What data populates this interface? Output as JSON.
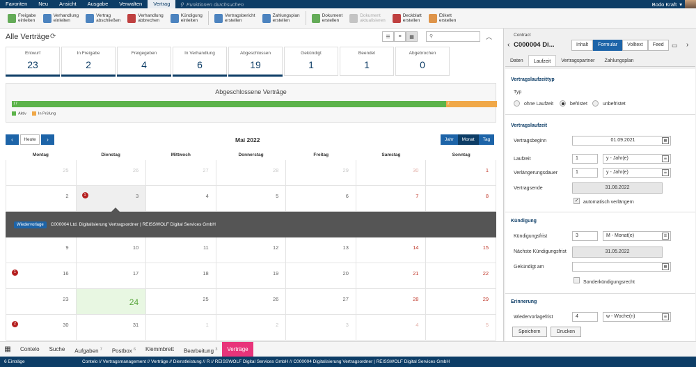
{
  "menu": {
    "items": [
      "Favoriten",
      "Neu",
      "Ansicht",
      "Ausgabe",
      "Verwalten",
      "Vertrag"
    ],
    "active_index": 5,
    "search_placeholder": "Funktionen durchsuchen",
    "user_name": "Bodo Kraft"
  },
  "ribbon": [
    {
      "l1": "Freigabe",
      "l2": "einleiten",
      "icon": "approval-icon",
      "color": "#4a9d3c"
    },
    {
      "l1": "Verhandlung",
      "l2": "einleiten",
      "icon": "negotiation-icon",
      "color": "#2e6fb5"
    },
    {
      "l1": "Vertrag",
      "l2": "abschließen",
      "icon": "contract-close-icon",
      "color": "#2e6fb5"
    },
    {
      "l1": "Verhandlung",
      "l2": "abbrechen",
      "icon": "negotiation-cancel-icon",
      "color": "#b52020"
    },
    {
      "l1": "Kündigung",
      "l2": "einleiten",
      "icon": "termination-icon",
      "color": "#2e6fb5"
    },
    {
      "l1": "Vertragsbericht",
      "l2": "erstellen",
      "icon": "report-icon",
      "color": "#2e6fb5"
    },
    {
      "l1": "Zahlungsplan",
      "l2": "erstellen",
      "icon": "payment-plan-icon",
      "color": "#2e6fb5"
    },
    {
      "l1": "Dokument",
      "l2": "erstellen",
      "icon": "document-add-icon",
      "color": "#4a9d3c"
    },
    {
      "l1": "Dokument",
      "l2": "aktualisieren",
      "icon": "document-refresh-icon",
      "color": "#bbbbbb",
      "disabled": true
    },
    {
      "l1": "Deckblatt",
      "l2": "erstellen",
      "icon": "cover-sheet-icon",
      "color": "#b52020"
    },
    {
      "l1": "Etikett",
      "l2": "erstellen",
      "icon": "label-icon",
      "color": "#d9822b"
    }
  ],
  "list": {
    "title": "Alle Verträge",
    "search_placeholder": ""
  },
  "tiles": [
    {
      "label": "Entwurf",
      "value": "23",
      "bar": true
    },
    {
      "label": "In Freigabe",
      "value": "2",
      "bar": true
    },
    {
      "label": "Freigegeben",
      "value": "4",
      "bar": true
    },
    {
      "label": "In Verhandlung",
      "value": "6",
      "bar": true
    },
    {
      "label": "Abgeschlossen",
      "value": "19",
      "bar": true
    },
    {
      "label": "Gekündigt",
      "value": "1",
      "bar": false
    },
    {
      "label": "Beendet",
      "value": "1",
      "bar": false
    },
    {
      "label": "Abgebrochen",
      "value": "0",
      "bar": false
    }
  ],
  "chart_data": {
    "type": "bar",
    "title": "Abgeschlossene Verträge",
    "series": [
      {
        "name": "Aktiv",
        "values": [
          17
        ],
        "color": "#5cb34a"
      },
      {
        "name": "In Prüfung",
        "values": [
          2
        ],
        "color": "#f0a848"
      }
    ],
    "stacked": true,
    "orientation": "horizontal",
    "legend": "bottom-left"
  },
  "calendar": {
    "today_label": "Heute",
    "month_title": "Mai 2022",
    "views": [
      "Jahr",
      "Monat",
      "Tag"
    ],
    "active_view": 1,
    "weekdays": [
      "Montag",
      "Dienstag",
      "Mittwoch",
      "Donnerstag",
      "Freitag",
      "Samstag",
      "Sonntag"
    ],
    "weeks": [
      [
        {
          "d": "25",
          "out": true
        },
        {
          "d": "26",
          "out": true
        },
        {
          "d": "27",
          "out": true
        },
        {
          "d": "28",
          "out": true
        },
        {
          "d": "29",
          "out": true
        },
        {
          "d": "30",
          "out": true,
          "wk": true
        },
        {
          "d": "1",
          "wk": true
        }
      ],
      [
        {
          "d": "2"
        },
        {
          "d": "3",
          "badge": "1",
          "sel": true
        },
        {
          "d": "4"
        },
        {
          "d": "5"
        },
        {
          "d": "6"
        },
        {
          "d": "7",
          "wk": true
        },
        {
          "d": "8",
          "wk": true
        }
      ],
      [
        {
          "d": "9"
        },
        {
          "d": "10"
        },
        {
          "d": "11"
        },
        {
          "d": "12"
        },
        {
          "d": "13"
        },
        {
          "d": "14",
          "wk": true
        },
        {
          "d": "15",
          "wk": true
        }
      ],
      [
        {
          "d": "16",
          "badge": "1"
        },
        {
          "d": "17"
        },
        {
          "d": "18"
        },
        {
          "d": "19"
        },
        {
          "d": "20"
        },
        {
          "d": "21",
          "wk": true
        },
        {
          "d": "22",
          "wk": true
        }
      ],
      [
        {
          "d": "23"
        },
        {
          "d": "24",
          "today": true
        },
        {
          "d": "25"
        },
        {
          "d": "26"
        },
        {
          "d": "27"
        },
        {
          "d": "28",
          "wk": true
        },
        {
          "d": "29",
          "wk": true
        }
      ],
      [
        {
          "d": "30",
          "badge": "2"
        },
        {
          "d": "31"
        },
        {
          "d": "1",
          "out": true
        },
        {
          "d": "2",
          "out": true
        },
        {
          "d": "3",
          "out": true
        },
        {
          "d": "4",
          "out": true,
          "wk": true
        },
        {
          "d": "5",
          "out": true,
          "wk": true
        }
      ]
    ],
    "popup": {
      "tag": "Wiedervorlage",
      "text": "C000004 Ltd. Digitalisierung Vertragsordner | REISSWOLF Digital Services GmbH"
    }
  },
  "bottom_tabs": [
    {
      "label": "Contelo",
      "count": ""
    },
    {
      "label": "Suche",
      "count": ""
    },
    {
      "label": "Aufgaben",
      "count": "7"
    },
    {
      "label": "Postbox",
      "count": "6"
    },
    {
      "label": "Klemmbrett",
      "count": ""
    },
    {
      "label": "Bearbeitung",
      "count": "3"
    },
    {
      "label": "Verträge",
      "count": "",
      "active": true
    }
  ],
  "status": {
    "entries": "6 Einträge",
    "path": "Contelo // Vertragsmanagement // Verträge // Dienstleistung // R // REISSWOLF Digital Services GmbH // C000004 Digitalisierung Vertragsordner | REISSWOLF Digital Services GmbH"
  },
  "panel": {
    "label": "Contract",
    "title": "C000004 Di...",
    "modes": [
      "Inhalt",
      "Formular",
      "Volltext",
      "Feed"
    ],
    "active_mode": 1,
    "tabs": [
      "Daten",
      "Laufzeit",
      "Vertragspartner",
      "Zahlungsplan"
    ],
    "active_tab": 1,
    "sec_typ": "Vertragslaufzeittyp",
    "typ_label": "Typ",
    "typ_options": [
      "ohne Laufzeit",
      "befristet",
      "unbefristet"
    ],
    "typ_selected": 1,
    "sec_laufzeit": "Vertragslaufzeit",
    "beginn_label": "Vertragsbeginn",
    "beginn_value": "01.09.2021",
    "laufzeit_label": "Laufzeit",
    "laufzeit_value": "1",
    "laufzeit_unit": "y - Jahr(e)",
    "verl_label": "Verlängerungsdauer",
    "verl_value": "1",
    "verl_unit": "y - Jahr(e)",
    "ende_label": "Vertragsende",
    "ende_value": "31.08.2022",
    "auto_label": "automatisch verlängern",
    "sec_kuendigung": "Kündigung",
    "frist_label": "Kündigungsfrist",
    "frist_value": "3",
    "frist_unit": "M - Monat(e)",
    "next_label": "Nächste Kündigungsfrist",
    "next_value": "31.05.2022",
    "gekuendigt_label": "Gekündigt am",
    "gekuendigt_value": "",
    "sonder_label": "Sonderkündigungsrecht",
    "sec_erinnerung": "Erinnerung",
    "wv_label": "Wiedervorlagefrist",
    "wv_value": "4",
    "wv_unit": "w - Woche(n)",
    "save_label": "Speichern",
    "print_label": "Drucken"
  }
}
